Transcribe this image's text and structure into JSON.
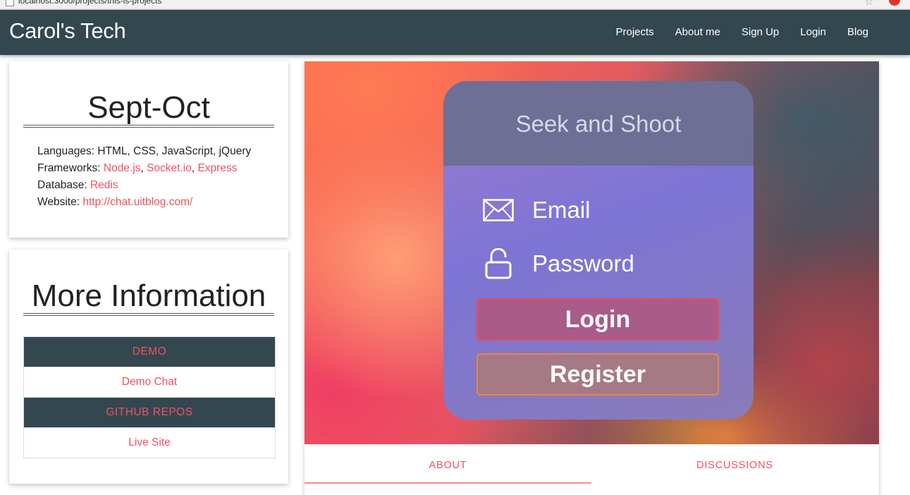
{
  "browser": {
    "url": "localhost:3000/projects/this-is-projects"
  },
  "navbar": {
    "brand": "Carol's Tech",
    "links": [
      "Projects",
      "About me",
      "Sign Up",
      "Login",
      "Blog"
    ]
  },
  "dates_card": {
    "title": "Sept-Oct",
    "languages_label": "Languages:",
    "languages_value": "HTML, CSS, JavaScript, jQuery",
    "frameworks_label": "Frameworks:",
    "frameworks": [
      "Node.js",
      "Socket.io",
      "Express"
    ],
    "database_label": "Database:",
    "database_value": "Redis",
    "website_label": "Website:",
    "website_value": "http://chat.uitblog.com/"
  },
  "more_card": {
    "title": "More Information",
    "rows": [
      {
        "label": "DEMO",
        "type": "header"
      },
      {
        "label": "Demo Chat",
        "type": "link"
      },
      {
        "label": "GITHUB REPOS",
        "type": "header"
      },
      {
        "label": "Live Site",
        "type": "link"
      }
    ]
  },
  "hero": {
    "app_title": "Seek and Shoot",
    "email_label": "Email",
    "password_label": "Password",
    "login_label": "Login",
    "register_label": "Register",
    "icons": [
      "envelope-icon",
      "unlocked-padlock-icon"
    ]
  },
  "tabs": [
    "ABOUT",
    "DISCUSSIONS"
  ],
  "colors": {
    "navbar": "#33474f",
    "accent": "#ef5261"
  }
}
